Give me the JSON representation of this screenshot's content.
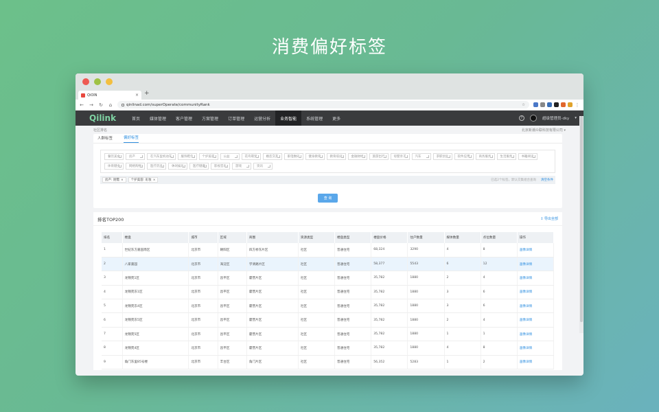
{
  "hero": {
    "title": "消费偏好标签"
  },
  "browser": {
    "tab_title": "QiOIN",
    "tab_close": "×",
    "new_tab": "+",
    "url": "qinlinad.com/superOperate/communityRank"
  },
  "nav": {
    "logo": "Qilink",
    "items": [
      "首页",
      "媒体管理",
      "客户管理",
      "方案管理",
      "订单管理",
      "运营分析",
      "业务智能",
      "系统管理",
      "更多"
    ],
    "active_index": 6,
    "user": "超级管理员-dky"
  },
  "sub": {
    "breadcrumb": "社区排名",
    "company": "北京新潮众联科技有限公司"
  },
  "filter": {
    "tabs": [
      "人群标签",
      "偏好标签"
    ],
    "active_tab": 1,
    "tags": [
      "餐饮美食",
      "房产",
      "在汽车里机动车",
      "服饰鞋包",
      "个护美容",
      "公益",
      "花鸟萌宠",
      "婚恋交友",
      "家电数码",
      "健身教育",
      "教育培训",
      "金融财经",
      "旅游出行",
      "母婴亲子",
      "汽车",
      "求职创业",
      "软件应用",
      "商务服务",
      "生活服务",
      "书籍阅读",
      "体育健身",
      "网络购物",
      "医疗药品",
      "休闲娱乐",
      "医疗健康",
      "影视音乐",
      "游戏",
      "资讯"
    ],
    "selected": [
      "房产: 刚需",
      "个护美容: 彩妆"
    ],
    "selected_info": "已选2个标签，默认交集组合查询",
    "clear_label": "清空条件",
    "query_label": "查 询"
  },
  "ranking": {
    "title": "排名TOP200",
    "export_label": "导出全部",
    "columns": [
      "排名",
      "楼盘",
      "城市",
      "区域",
      "商圈",
      "资源类型",
      "楼盘类型",
      "楼盘价格",
      "住户数量",
      "媒体数量",
      "点位数量",
      "操作"
    ],
    "rows": [
      [
        "1",
        "世纪东方嘉园南区",
        "北京市",
        "朝阳区",
        "四方桥东片区",
        "社区",
        "普通住宅",
        "68,324",
        "3290",
        "4",
        "8",
        "画像详情"
      ],
      [
        "2",
        "八家嘉园",
        "北京市",
        "海淀区",
        "学清路片区",
        "社区",
        "普通住宅",
        "58,377",
        "5543",
        "6",
        "12",
        "画像详情"
      ],
      [
        "3",
        "龙锦苑1区",
        "北京市",
        "昌平区",
        "霍营片区",
        "社区",
        "普通住宅",
        "35,782",
        "1880",
        "2",
        "4",
        "画像详情"
      ],
      [
        "4",
        "龙锦苑东1区",
        "北京市",
        "昌平区",
        "霍营片区",
        "社区",
        "普通住宅",
        "35,782",
        "1880",
        "3",
        "6",
        "画像详情"
      ],
      [
        "5",
        "龙锦苑东4区",
        "北京市",
        "昌平区",
        "霍营片区",
        "社区",
        "普通住宅",
        "35,782",
        "1880",
        "3",
        "6",
        "画像详情"
      ],
      [
        "6",
        "龙锦苑东5区",
        "北京市",
        "昌平区",
        "霍营片区",
        "社区",
        "普通住宅",
        "35,782",
        "1880",
        "2",
        "4",
        "画像详情"
      ],
      [
        "7",
        "龙锦苑5区",
        "北京市",
        "昌平区",
        "霍营片区",
        "社区",
        "普通住宅",
        "35,782",
        "1880",
        "1",
        "1",
        "画像详情"
      ],
      [
        "8",
        "龙锦苑4区",
        "北京市",
        "昌平区",
        "霍营片区",
        "社区",
        "普通住宅",
        "35,782",
        "1880",
        "4",
        "8",
        "画像详情"
      ],
      [
        "9",
        "角门东里85号楼",
        "北京市",
        "丰台区",
        "角门片区",
        "社区",
        "普通住宅",
        "56,352",
        "5283",
        "1",
        "2",
        "画像详情"
      ]
    ]
  }
}
